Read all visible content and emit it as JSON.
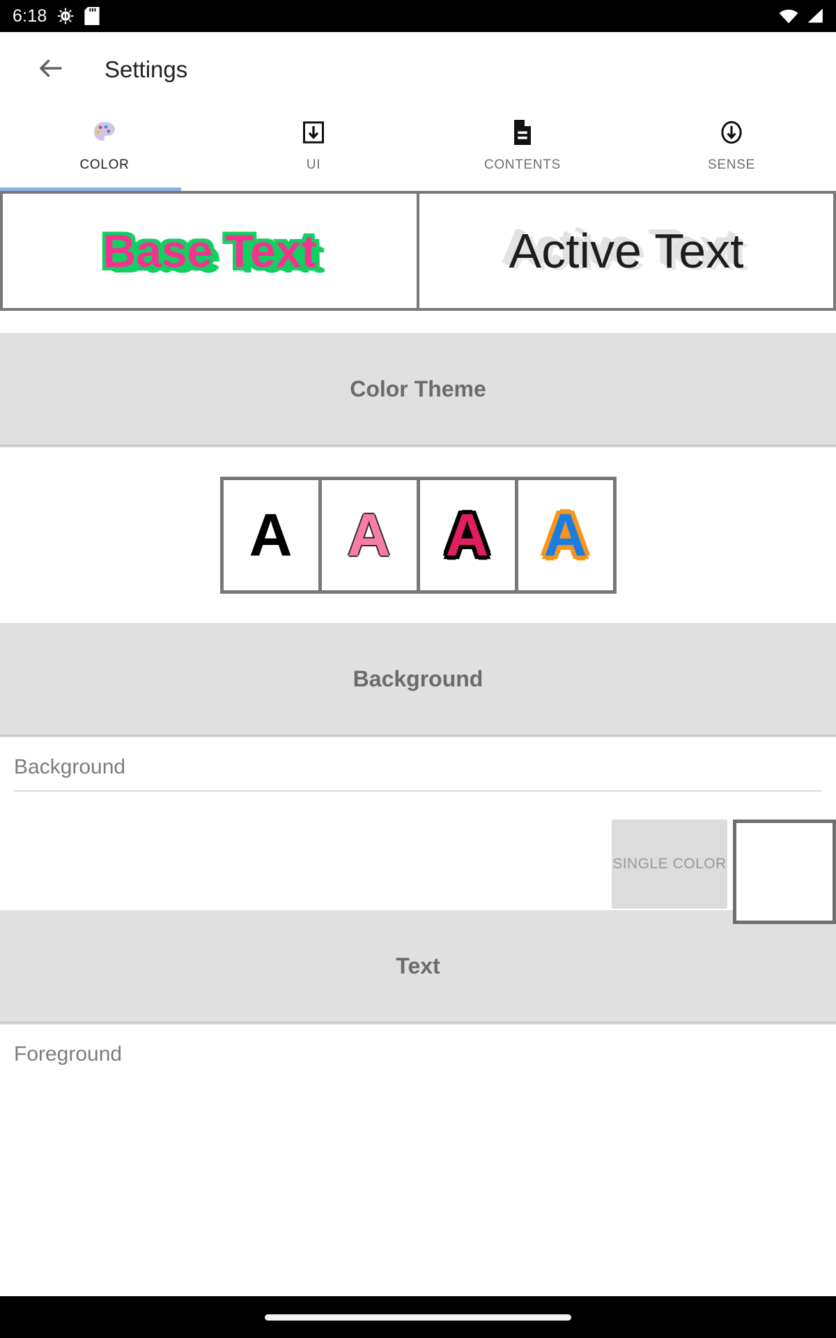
{
  "statusbar": {
    "time": "6:18",
    "icons": [
      "android-bug-icon",
      "sd-card-icon"
    ],
    "right_icons": [
      "wifi-icon",
      "signal-icon"
    ]
  },
  "toolbar": {
    "back_icon": "back-arrow-icon",
    "title": "Settings"
  },
  "tabs": {
    "selected_index": 0,
    "items": [
      {
        "label": "COLOR",
        "icon": "palette-icon"
      },
      {
        "label": "UI",
        "icon": "download-box-icon"
      },
      {
        "label": "CONTENTS",
        "icon": "document-icon"
      },
      {
        "label": "SENSE",
        "icon": "circle-down-arrow-icon"
      }
    ]
  },
  "preview": {
    "base": {
      "text": "Base Text",
      "fill_color": "#f4338f",
      "outline_color": "#12cf62"
    },
    "active": {
      "text": "Active Text",
      "fill_color": "#1d1d1d",
      "outline_color": "#e2e2e2"
    }
  },
  "sections": {
    "color_theme": {
      "title": "Color Theme"
    },
    "background": {
      "title": "Background"
    },
    "text": {
      "title": "Text"
    }
  },
  "color_theme": {
    "swatches": [
      {
        "glyph": "A",
        "fill": "#000000",
        "outline": "none"
      },
      {
        "glyph": "A",
        "fill": "#f97ca8",
        "outline": "#2a2a2a"
      },
      {
        "glyph": "A",
        "fill": "#e01e62",
        "outline": "#000000"
      },
      {
        "glyph": "A",
        "fill": "#1a7ee0",
        "outline": "#f7941d"
      }
    ]
  },
  "background_pref": {
    "title": "Background",
    "mode_label": "SINGLE COLOR",
    "color_value": "#ffffff"
  },
  "text_pref": {
    "title": "Foreground"
  },
  "navbar": {
    "pill": "home-gesture-pill"
  }
}
